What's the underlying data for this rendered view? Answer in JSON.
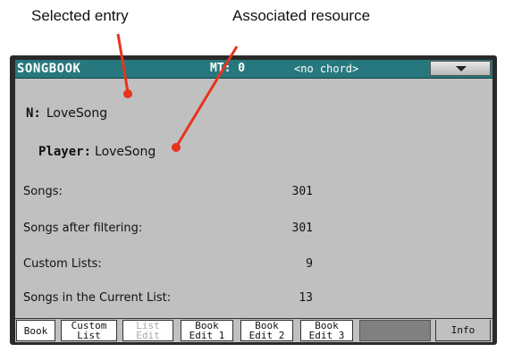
{
  "callouts": {
    "selected_entry": "Selected entry",
    "associated_resource": "Associated resource"
  },
  "header": {
    "title": "SONGBOOK",
    "mt": "MT: 0",
    "chord": "<no chord>"
  },
  "entry": {
    "name_label": "N:",
    "name_value": "LoveSong",
    "player_label": "Player:",
    "player_value": "LoveSong"
  },
  "info": [
    {
      "label": "Songs:",
      "value": "301"
    },
    {
      "label": "Songs after filtering:",
      "value": "301"
    },
    {
      "label": "Custom Lists:",
      "value": "9"
    },
    {
      "label": "Songs in the Current List:",
      "value": "13"
    }
  ],
  "tabs": [
    {
      "label": "Book",
      "enabled": true
    },
    {
      "label": "Custom\nList",
      "enabled": true
    },
    {
      "label": "List\nEdit",
      "enabled": false
    },
    {
      "label": "Book\nEdit 1",
      "enabled": true
    },
    {
      "label": "Book\nEdit 2",
      "enabled": true
    },
    {
      "label": "Book\nEdit 3",
      "enabled": true
    },
    {
      "label": "Info",
      "enabled": true,
      "active": true
    }
  ],
  "colors": {
    "header": "#27787e",
    "panel": "#c0c0c0",
    "callout_line": "#e8341c"
  }
}
